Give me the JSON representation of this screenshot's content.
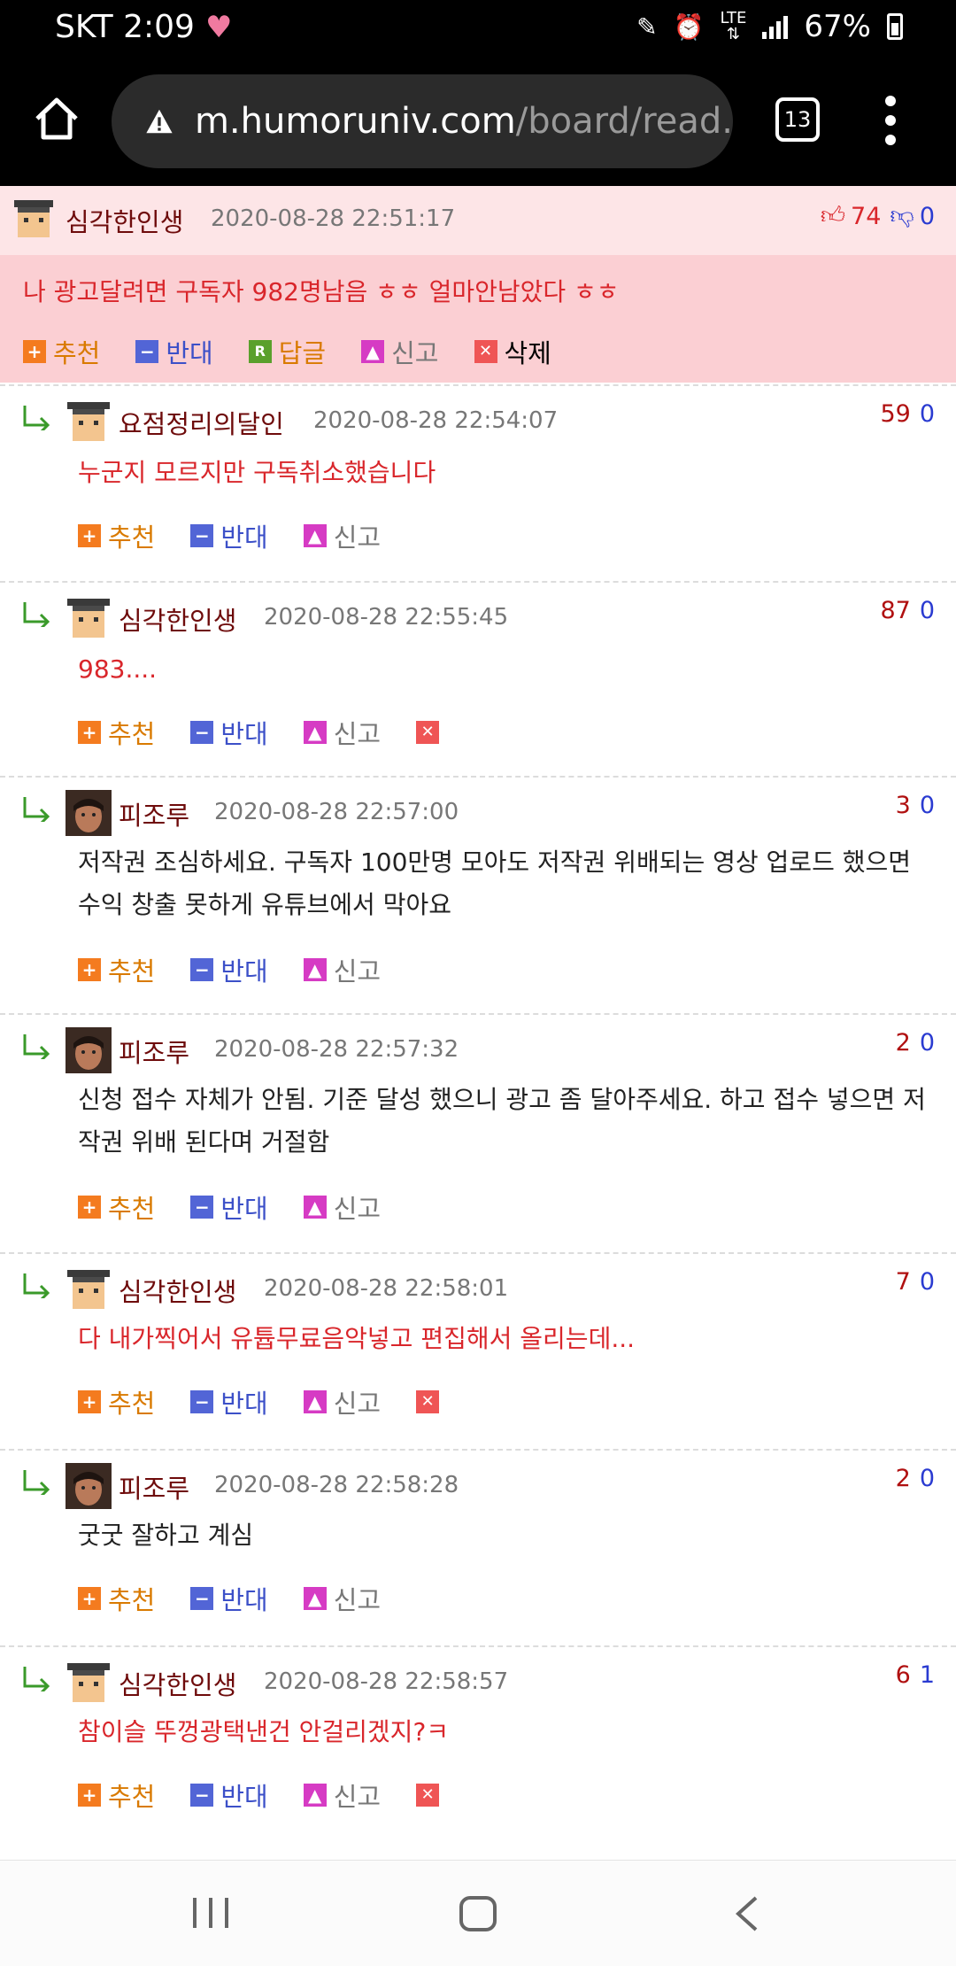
{
  "status": {
    "carrier_time": "SKT 2:09",
    "network": "LTE",
    "battery": "67%"
  },
  "browser": {
    "url_host": "m.humoruniv.com",
    "url_path": "/board/read.",
    "tab_count": "13"
  },
  "post": {
    "nick": "심각한인생",
    "date": "2020-08-28 22:51:17",
    "likes": "74",
    "dislikes": "0",
    "text": "나 광고달려면 구독자 982명남음 ㅎㅎ 얼마안남았다 ㅎㅎ",
    "actions": {
      "recommend": "추천",
      "oppose": "반대",
      "reply": "답글",
      "report": "신고",
      "delete": "삭제"
    }
  },
  "labels": {
    "recommend": "추천",
    "oppose": "반대",
    "report": "신고"
  },
  "comments": [
    {
      "nick": "요점정리의달인",
      "date": "2020-08-28 22:54:07",
      "up": "59",
      "down": "0",
      "text": "누군지 모르지만 구독취소했습니다"
    },
    {
      "nick": "심각한인생",
      "date": "2020-08-28 22:55:45",
      "up": "87",
      "down": "0",
      "text": "983...."
    },
    {
      "nick": "피조루",
      "date": "2020-08-28 22:57:00",
      "up": "3",
      "down": "0",
      "text": "저작권 조심하세요. 구독자 100만명 모아도 저작권 위배되는 영상 업로드 했으면 수익 창출 못하게 유튜브에서 막아요"
    },
    {
      "nick": "피조루",
      "date": "2020-08-28 22:57:32",
      "up": "2",
      "down": "0",
      "text": "신청 접수 자체가 안됨. 기준 달성 했으니 광고 좀 달아주세요. 하고 접수 넣으면 저작권 위배 된다며 거절함"
    },
    {
      "nick": "심각한인생",
      "date": "2020-08-28 22:58:01",
      "up": "7",
      "down": "0",
      "text": "다 내가찍어서 유튭무료음악넣고 편집해서 올리는데..."
    },
    {
      "nick": "피조루",
      "date": "2020-08-28 22:58:28",
      "up": "2",
      "down": "0",
      "text": "굿굿 잘하고 계심"
    },
    {
      "nick": "심각한인생",
      "date": "2020-08-28 22:58:57",
      "up": "6",
      "down": "1",
      "text": "참이슬 뚜껑광택낸건 안걸리겠지?ㅋ"
    }
  ]
}
